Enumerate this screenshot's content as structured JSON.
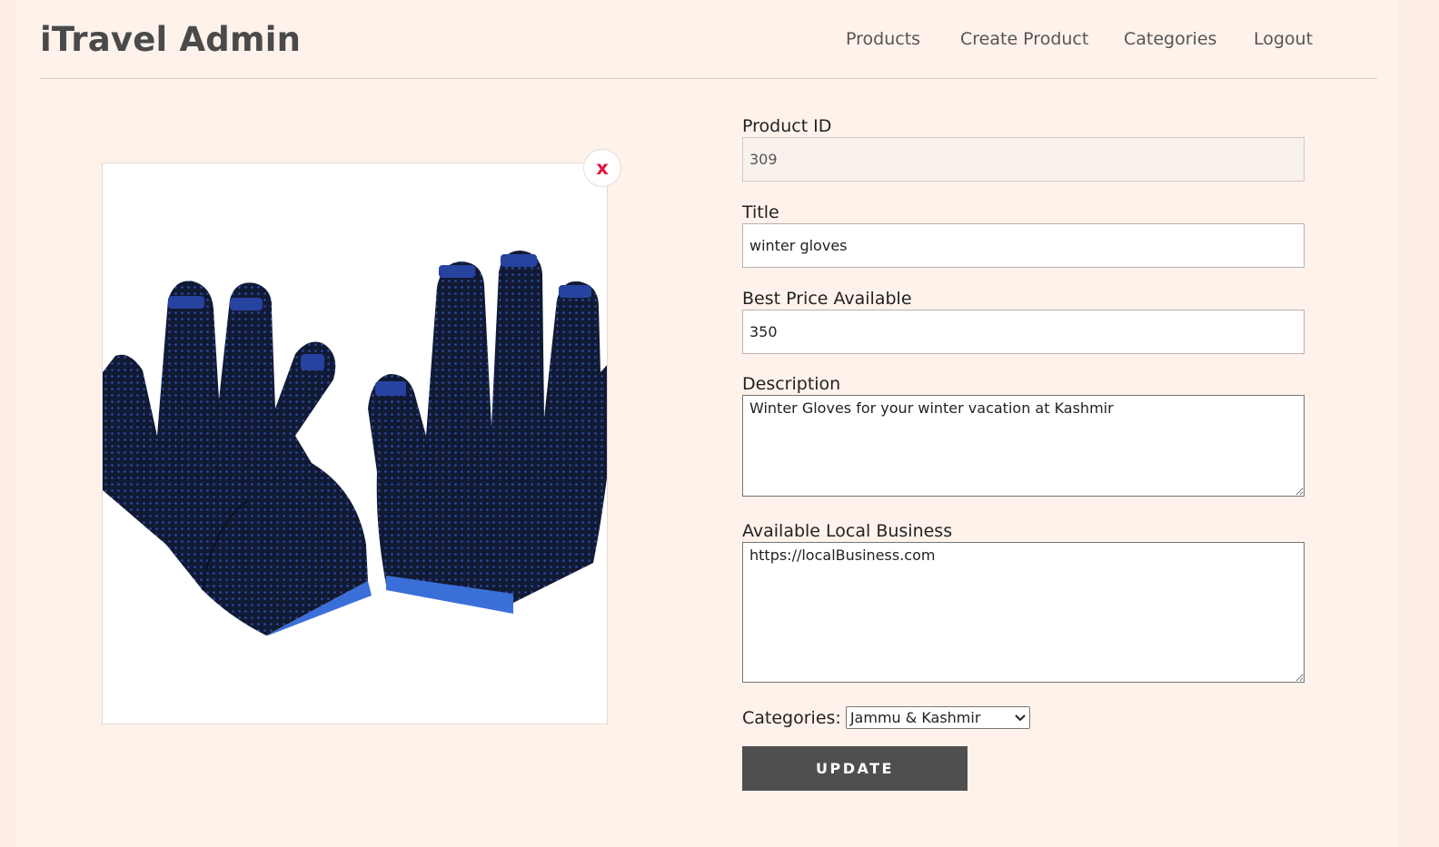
{
  "header": {
    "brand": "iTravel Admin",
    "nav": [
      {
        "label": "Products"
      },
      {
        "label": "Create Product"
      },
      {
        "label": "Categories"
      },
      {
        "label": "Logout"
      }
    ]
  },
  "image": {
    "icon": "gloves-product-image",
    "remove_label": "x"
  },
  "form": {
    "product_id": {
      "label": "Product ID",
      "value": "309"
    },
    "title": {
      "label": "Title",
      "value": "winter gloves"
    },
    "price": {
      "label": "Best Price Available",
      "value": "350"
    },
    "description": {
      "label": "Description",
      "value": "Winter Gloves for your winter vacation at Kashmir"
    },
    "local_business": {
      "label": "Available Local Business",
      "value": "https://localBusiness.com"
    },
    "categories": {
      "label": "Categories:",
      "selected": "Jammu & Kashmir"
    },
    "update_label": "UPDATE"
  },
  "colors": {
    "background": "#fef2eb",
    "brand_text": "#4a4a4a",
    "button_bg": "#4f4f4f",
    "remove_x": "#e0163c"
  }
}
